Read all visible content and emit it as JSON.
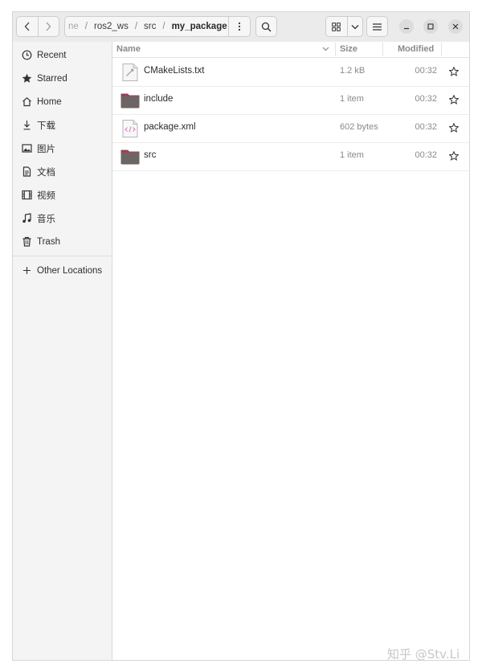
{
  "pathbar": {
    "crumbs": [
      "ne",
      "ros2_ws",
      "src",
      "my_package"
    ],
    "separator": "/"
  },
  "sidebar": {
    "items": [
      {
        "label": "Recent",
        "icon": "clock-icon"
      },
      {
        "label": "Starred",
        "icon": "star-icon"
      },
      {
        "label": "Home",
        "icon": "home-icon"
      },
      {
        "label": "下载",
        "icon": "download-icon"
      },
      {
        "label": "图片",
        "icon": "image-icon"
      },
      {
        "label": "文档",
        "icon": "document-icon"
      },
      {
        "label": "视频",
        "icon": "video-icon"
      },
      {
        "label": "音乐",
        "icon": "music-icon"
      },
      {
        "label": "Trash",
        "icon": "trash-icon"
      }
    ],
    "other_locations": {
      "label": "Other Locations",
      "icon": "plus-icon"
    }
  },
  "columns": {
    "name": "Name",
    "size": "Size",
    "modified": "Modified"
  },
  "files": [
    {
      "name": "CMakeLists.txt",
      "size": "1.2 kB",
      "modified": "00:32",
      "icon": "script-file-icon"
    },
    {
      "name": "include",
      "size": "1 item",
      "modified": "00:32",
      "icon": "folder-icon"
    },
    {
      "name": "package.xml",
      "size": "602 bytes",
      "modified": "00:32",
      "icon": "xml-file-icon"
    },
    {
      "name": "src",
      "size": "1 item",
      "modified": "00:32",
      "icon": "folder-icon"
    }
  ],
  "watermark": "知乎 @Stv.Li",
  "colors": {
    "folder": "#6d6464",
    "folder_tab": "#a03c55",
    "headerbar": "#ebebeb",
    "sidebar": "#f4f4f4"
  }
}
